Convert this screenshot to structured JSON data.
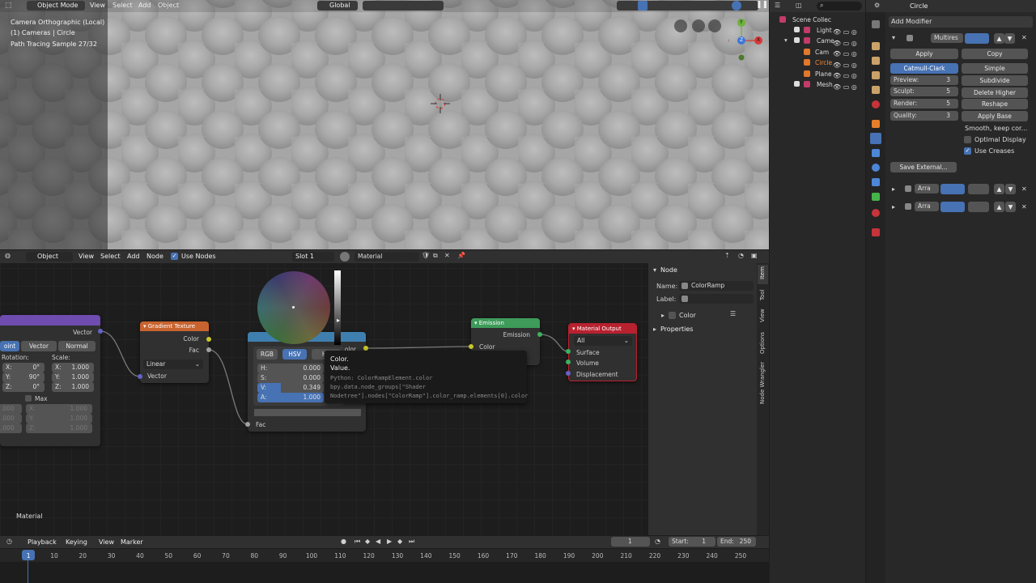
{
  "viewport": {
    "mode_label": "Object Mode",
    "menus": [
      "View",
      "Select",
      "Add",
      "Object"
    ],
    "transform_orientation": "Global",
    "overlay_lines": [
      "Camera Orthographic (Local)",
      "(1) Cameras | Circle",
      "Path Tracing Sample 27/32"
    ],
    "gizmo": {
      "x": "X",
      "y": "Y",
      "z": "Z"
    }
  },
  "outliner": {
    "search_placeholder": "",
    "items": [
      {
        "label": "Scene Collec"
      },
      {
        "label": "Light"
      },
      {
        "label": "Came"
      },
      {
        "label": "Cam"
      },
      {
        "label": "Circle"
      },
      {
        "label": "Plane"
      },
      {
        "label": "Mesh"
      }
    ]
  },
  "properties": {
    "object_name": "Circle",
    "add_modifier": "Add Modifier",
    "modifier_name": "Multires",
    "apply": "Apply",
    "copy": "Copy",
    "catmull": "Catmull-Clark",
    "simple": "Simple",
    "preview_label": "Preview:",
    "preview_value": "3",
    "sculpt_label": "Sculpt:",
    "sculpt_value": "5",
    "render_label": "Render:",
    "render_value": "5",
    "quality_label": "Quality:",
    "quality_value": "3",
    "subdivide": "Subdivide",
    "delete_higher": "Delete Higher",
    "reshape": "Reshape",
    "apply_base": "Apply Base",
    "smooth": "Smooth, keep cor...",
    "optimal_display": "Optimal Display",
    "use_creases": "Use Creases",
    "save_external": "Save External...",
    "array1": "Arra",
    "array2": "Arra"
  },
  "node_editor": {
    "mode": "Object",
    "menus": [
      "View",
      "Select",
      "Add",
      "Node"
    ],
    "use_nodes": "Use Nodes",
    "slot": "Slot 1",
    "material": "Material",
    "footer_label": "Material",
    "sidebar": {
      "panel_title": "Node",
      "name_label": "Name:",
      "name_value": "ColorRamp",
      "label_label": "Label:",
      "label_value": "",
      "color_label": "Color",
      "properties_label": "Properties",
      "tabs": [
        "Item",
        "Tool",
        "View",
        "Options",
        "Node Wrangler"
      ]
    },
    "mapping_node": {
      "output": "Vector",
      "types": [
        "oint",
        "Vector",
        "Normal"
      ],
      "rotation_label": "Rotation:",
      "scale_label": "Scale:",
      "rx": "0°",
      "ry": "90°",
      "rz": "0°",
      "sx": "1.000",
      "sy": "1.000",
      "sz": "1.000",
      "max_label": "Max",
      "minvals": [
        ".000",
        ".000",
        ".000"
      ],
      "maxvals": [
        "1.000",
        "1.000",
        "1.000"
      ]
    },
    "gradient_node": {
      "title": "Gradient Texture",
      "out_color": "Color",
      "out_fac": "Fac",
      "type": "Linear",
      "in_vector": "Vector"
    },
    "colorpicker": {
      "modes": [
        "RGB",
        "HSV",
        "He"
      ],
      "h_label": "H:",
      "h_value": "0.000",
      "s_label": "S:",
      "s_value": "0.000",
      "v_label": "V:",
      "v_value": "0.349",
      "a_label": "A:",
      "a_value": "1.000"
    },
    "colorramp_node": {
      "out_color": "olor",
      "in_fac": "Fac"
    },
    "tooltip": {
      "title": "Color.",
      "subtitle": "Value.",
      "python1": "Python: ColorRampElement.color",
      "python2": "bpy.data.node_groups[\"Shader",
      "python3": "Nodetree\"].nodes[\"ColorRamp\"].color_ramp.elements[0].color"
    },
    "emission_node": {
      "title": "Emission",
      "out": "Emission",
      "in_color": "Color"
    },
    "output_node": {
      "title": "Material Output",
      "target": "All",
      "surface": "Surface",
      "volume": "Volume",
      "displacement": "Displacement"
    }
  },
  "timeline": {
    "menus": [
      "Playback",
      "Keying",
      "View",
      "Marker"
    ],
    "current_frame": "1",
    "start_label": "Start:",
    "start_value": "1",
    "end_label": "End:",
    "end_value": "250",
    "ruler": [
      "1",
      "10",
      "20",
      "30",
      "40",
      "50",
      "60",
      "70",
      "80",
      "90",
      "100",
      "110",
      "120",
      "130",
      "140",
      "150",
      "160",
      "170",
      "180",
      "190",
      "200",
      "210",
      "220",
      "230",
      "240",
      "250"
    ]
  },
  "colors": {
    "accent": "#4772b3",
    "gradient_header": "#c8632f",
    "emission_header": "#3e9b5a",
    "output_header": "#b8212f",
    "mapping_header": "#6e4cb0"
  }
}
